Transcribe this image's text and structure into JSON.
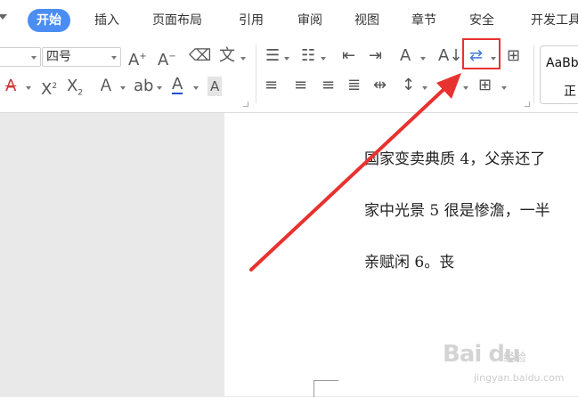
{
  "tabs": [
    {
      "label": "开始",
      "active": true
    },
    {
      "label": "插入"
    },
    {
      "label": "页面布局"
    },
    {
      "label": "引用"
    },
    {
      "label": "审阅"
    },
    {
      "label": "视图"
    },
    {
      "label": "章节"
    },
    {
      "label": "安全"
    },
    {
      "label": "开发工具"
    }
  ],
  "ribbon": {
    "font_size_value": "四号",
    "style_sample": "AaBb",
    "style_name": "正"
  },
  "document": {
    "lines": [
      "国家变卖典质 4，父亲还了",
      "家中光景 5 很是惨澹，一半",
      "亲赋闲 6。丧"
    ]
  },
  "watermark": {
    "logo": "Bai du",
    "sub": "经验",
    "url": "jingyan.baidu.com"
  },
  "colors": {
    "accent": "#4a8df3",
    "highlight": "#e8322f",
    "arrow": "#e8322f"
  }
}
